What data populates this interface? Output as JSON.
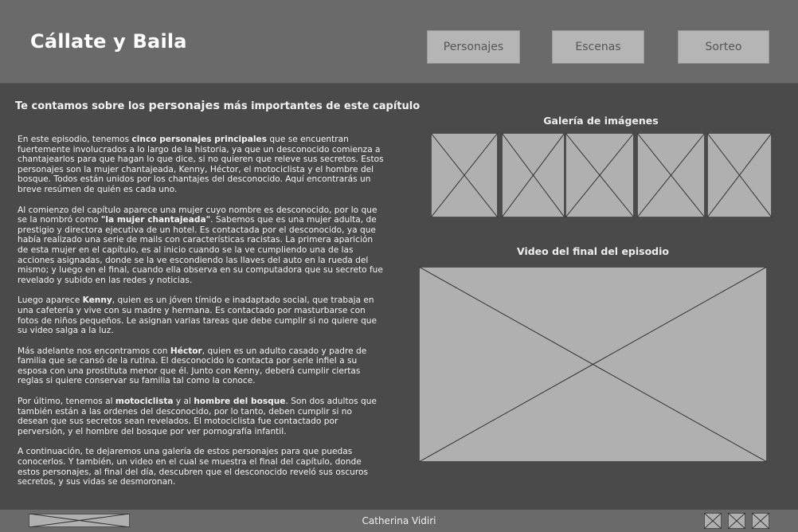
{
  "header": {
    "title": "Cállate y Baila",
    "nav": [
      "Personajes",
      "Escenas",
      "Sorteo"
    ]
  },
  "intro": {
    "prefix": "Te contamos sobre los ",
    "highlight": "personajes",
    "suffix": " más importantes de este capítulo"
  },
  "article": {
    "p1": [
      {
        "t": "En este episodio, tenemos ",
        "b": false
      },
      {
        "t": "cinco personajes principales",
        "b": true
      },
      {
        "t": " que se encuentran fuertemente involucrados a lo largo de la historia, ya que un desconocido comienza a chantajearlos para que hagan lo que dice, si no quieren que releve sus secretos. Estos personajes son la mujer chantajeada, Kenny, Héctor, el motociclista y el hombre del bosque. Todos están unidos por los chantajes del desconocido. Aquí encontrarás un breve resúmen de quién es cada uno.",
        "b": false
      }
    ],
    "p2": [
      {
        "t": " Al comienzo del capítulo aparece una mujer cuyo nombre es desconocido, por lo que se la nombró como ",
        "b": false
      },
      {
        "t": "\"la mujer chantajeada\"",
        "b": true
      },
      {
        "t": ". Sabemos que es una mujer adulta, de prestigio y directora ejecutiva de un hotel. Es contactada por el desconocido, ya que había realizado una serie de mails con características racistas. La primera aparición de esta mujer en el capítulo, es al inicio cuando se la ve cumpliendo una de las acciones asignadas, donde se la ve escondiendo las llaves del auto en la rueda del mismo; y luego en el final, cuando ella observa en su computadora que su secreto fue revelado y subido en las redes y noticias.",
        "b": false
      }
    ],
    "p3": [
      {
        "t": "Luego aparece ",
        "b": false
      },
      {
        "t": "Kenny",
        "b": true
      },
      {
        "t": ", quien es un jóven tímido e inadaptado social, que trabaja en una cafetería y vive con su madre y hermana. Es contactado por masturbarse con fotos de niños pequeños. Le asignan varias  tareas que debe cumplir si no quiere que su video salga a la luz.",
        "b": false
      }
    ],
    "p4": [
      {
        "t": "Más adelante nos encontramos con ",
        "b": false
      },
      {
        "t": "Héctor",
        "b": true
      },
      {
        "t": ", quien es un adulto casado y padre de familia que se cansó de la rutina. El desconocido lo contacta por serle infiel a su esposa con una prostituta menor que él. Junto con Kenny, deberá cumplir ciertas reglas si quiere conservar su familia tal como la conoce.",
        "b": false
      }
    ],
    "p5": [
      {
        "t": "Por último, tenemos al ",
        "b": false
      },
      {
        "t": "motociclista",
        "b": true
      },
      {
        "t": " y al ",
        "b": false
      },
      {
        "t": "hombre del bosque",
        "b": true
      },
      {
        "t": ". Son dos adultos que también están a las ordenes del desconocido, por lo tanto, deben cumplir si no desean que sus secretos sean revelados. El motociclista fue contactado por perversión, y el hombre del bosque por ver pornografía infantil.",
        "b": false
      }
    ],
    "p6": [
      {
        "t": "A continuación, te dejaremos una galería de estos personajes para que puedas conocerlos. Y también, un video en el cual se muestra el final del capítulo, donde estos personajes, al final del día, descubren que el desconocido reveló sus oscuros secretos, y sus vidas se desmoronan.",
        "b": false
      }
    ]
  },
  "gallery": {
    "title": "Galería de imágenes",
    "count": 5
  },
  "video": {
    "title": "Video del final del episodio"
  },
  "footer": {
    "name": "Catherina Vidiri",
    "social_icons": 3
  }
}
